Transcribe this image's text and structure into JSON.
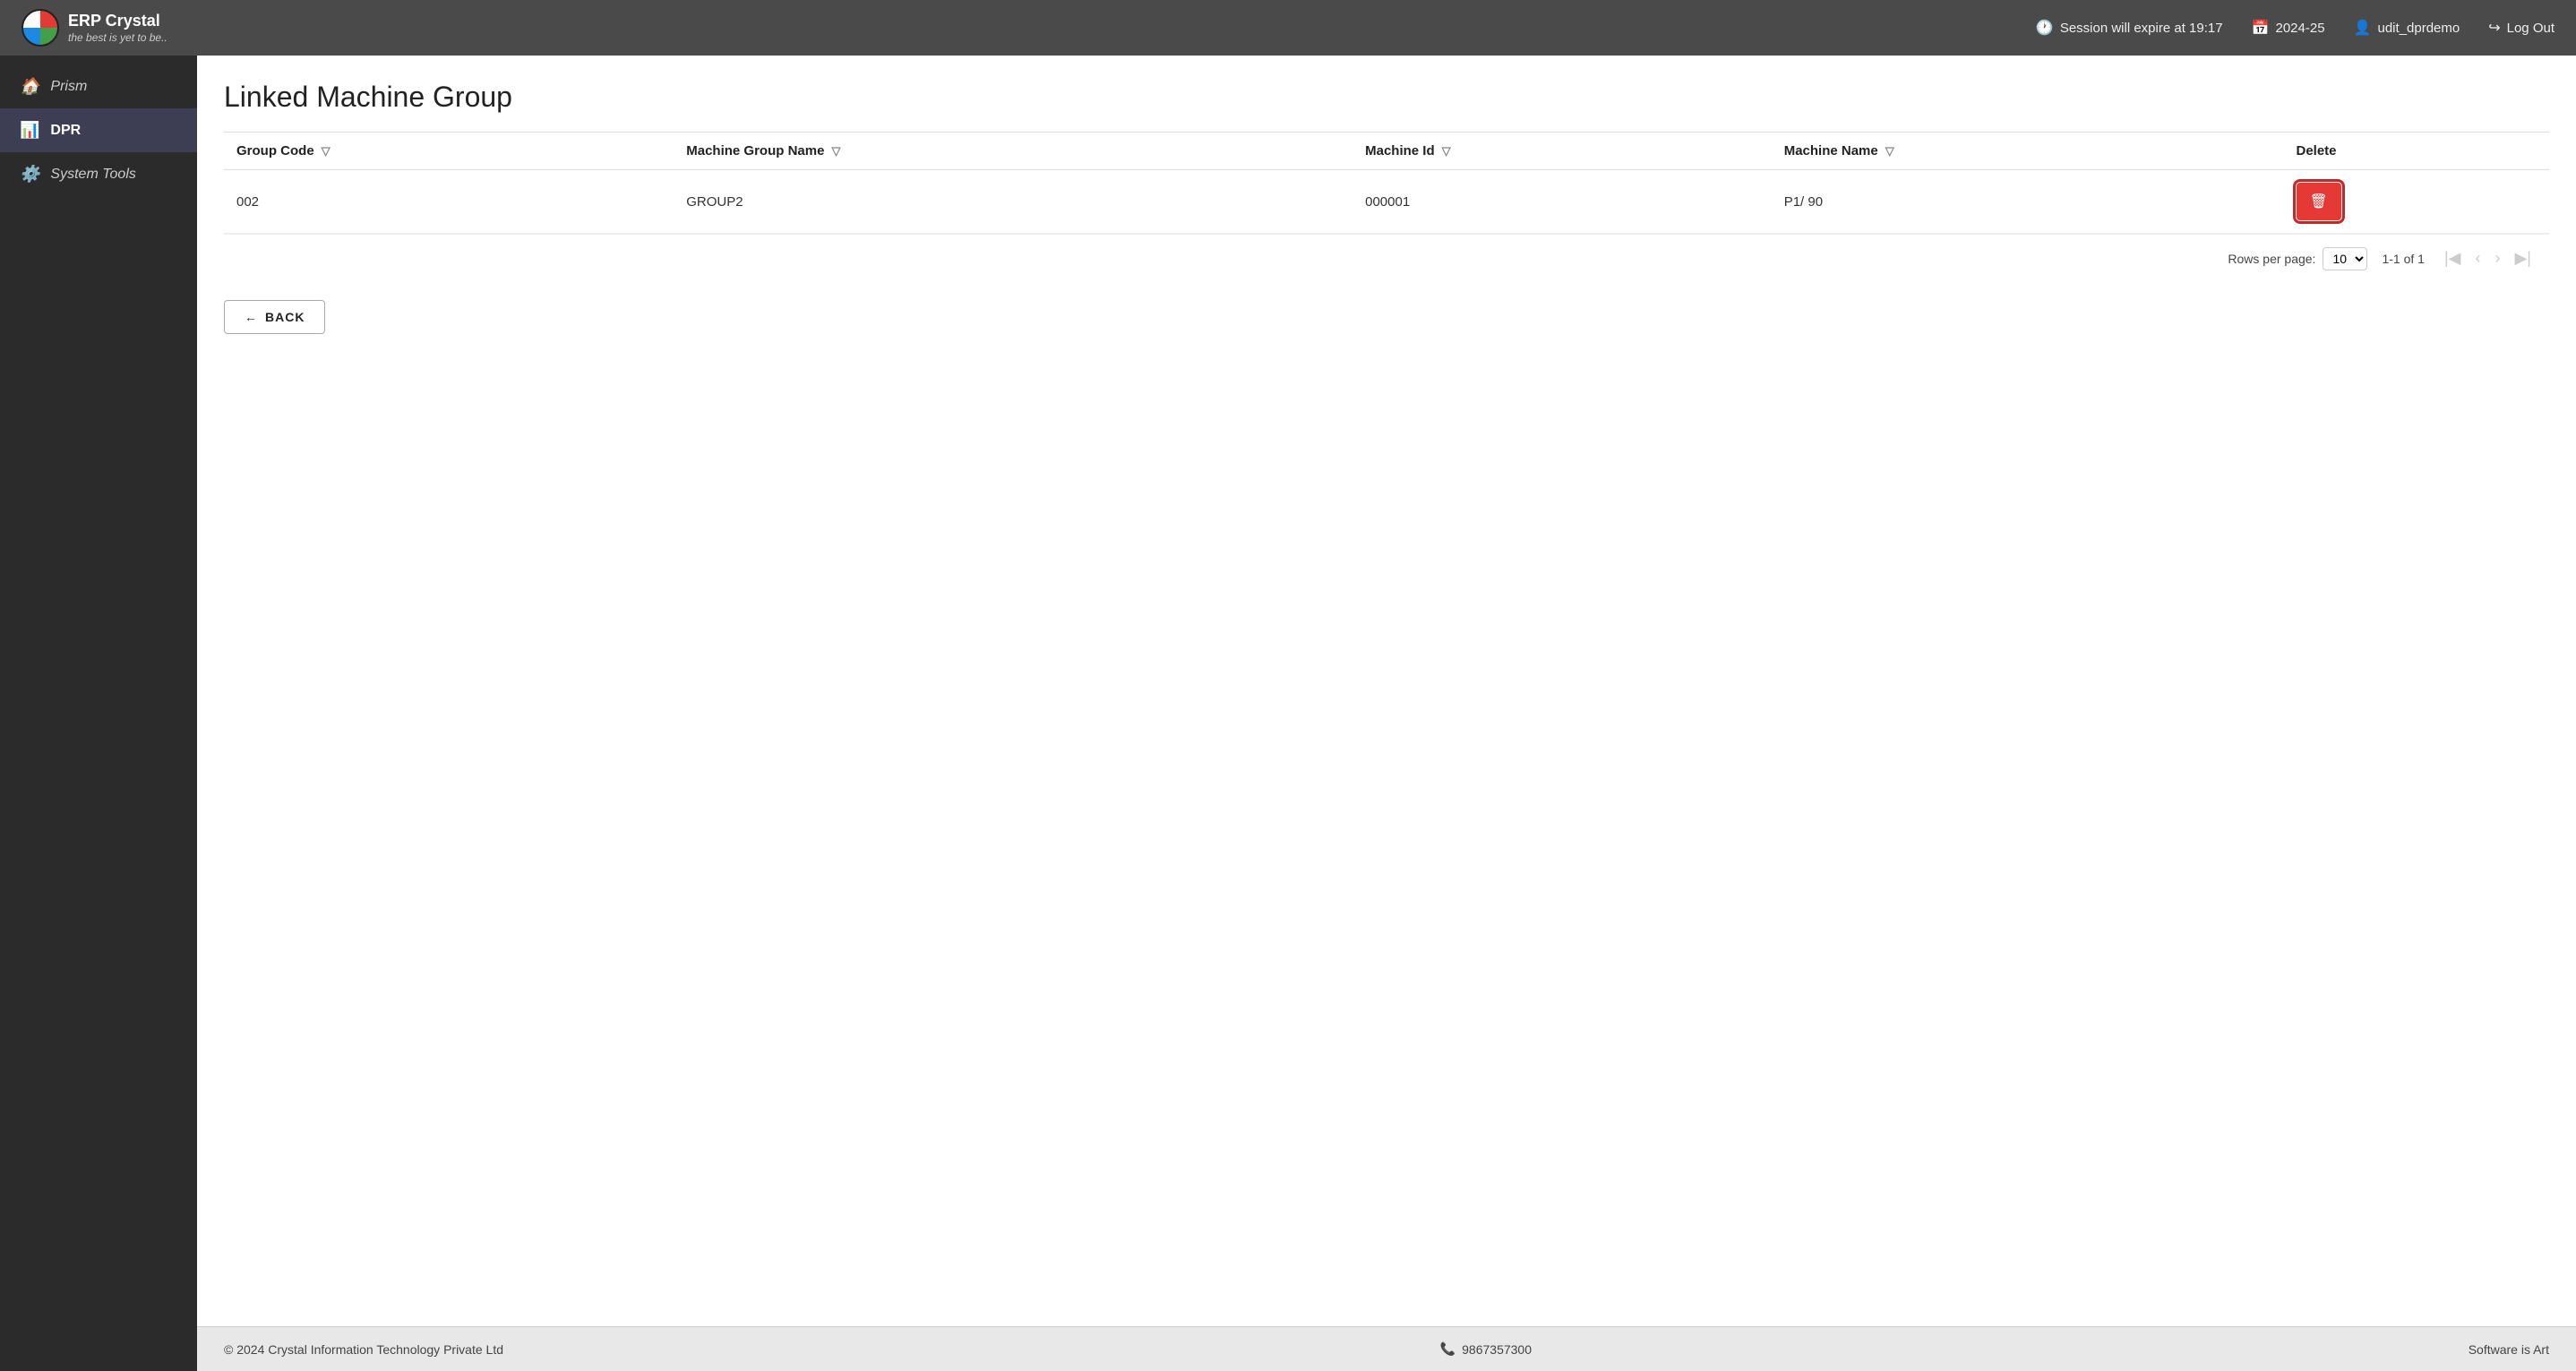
{
  "header": {
    "logo_title": "ERP Crystal",
    "logo_subtitle": "the best is yet to be..",
    "session": "Session will expire at 19:17",
    "year": "2024-25",
    "user": "udit_dprdemo",
    "logout_label": "Log Out"
  },
  "sidebar": {
    "items": [
      {
        "id": "prism",
        "label": "Prism",
        "icon": "🏠",
        "active": false
      },
      {
        "id": "dpr",
        "label": "DPR",
        "icon": "📊",
        "active": true
      },
      {
        "id": "system-tools",
        "label": "System Tools",
        "icon": "⚙️",
        "active": false
      }
    ]
  },
  "page": {
    "title": "Linked Machine Group",
    "columns": [
      {
        "id": "group_code",
        "label": "Group Code"
      },
      {
        "id": "machine_group_name",
        "label": "Machine Group Name"
      },
      {
        "id": "machine_id",
        "label": "Machine Id"
      },
      {
        "id": "machine_name",
        "label": "Machine Name"
      },
      {
        "id": "delete",
        "label": "Delete"
      }
    ],
    "rows": [
      {
        "group_code": "002",
        "machine_group_name": "GROUP2",
        "machine_id": "000001",
        "machine_name": "P1/ 90"
      }
    ],
    "pagination": {
      "rows_per_page_label": "Rows per page:",
      "rows_per_page_value": "10",
      "page_info": "1-1 of 1"
    },
    "back_button": "BACK"
  },
  "footer": {
    "copyright": "© 2024 Crystal Information Technology Private Ltd",
    "phone": "9867357300",
    "tagline": "Software is Art"
  }
}
